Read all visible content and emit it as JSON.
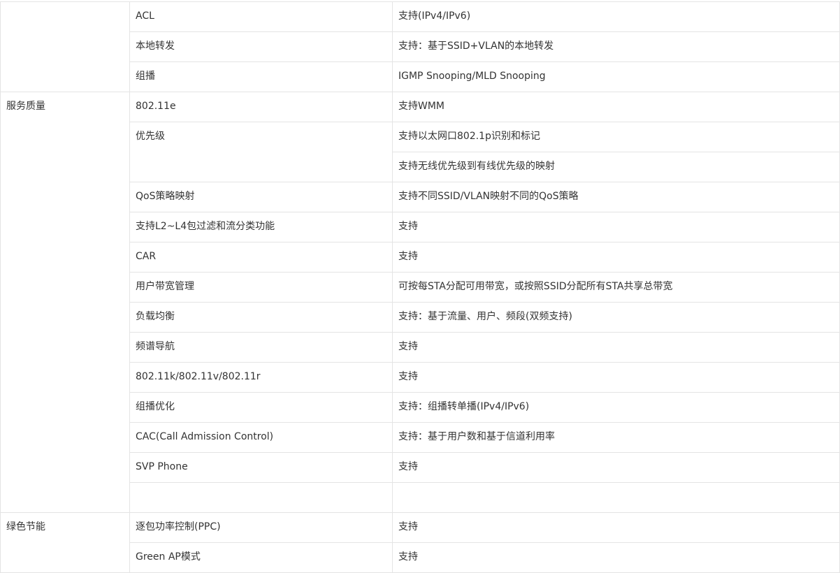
{
  "table": {
    "top_rows": [
      {
        "feature": "ACL",
        "value": "支持(IPv4/IPv6)"
      },
      {
        "feature": "本地转发",
        "value": "支持：基于SSID+VLAN的本地转发"
      },
      {
        "feature": "组播",
        "value": "IGMP Snooping/MLD Snooping"
      }
    ],
    "qos": {
      "category": "服务质量",
      "r802_11e": {
        "feature": "802.11e",
        "value": "支持WMM"
      },
      "priority": {
        "feature": "优先级",
        "value_1": "支持以太网口802.1p识别和标记",
        "value_2": "支持无线优先级到有线优先级的映射"
      },
      "rows": [
        {
          "feature": "QoS策略映射",
          "value": "支持不同SSID/VLAN映射不同的QoS策略"
        },
        {
          "feature": "支持L2~L4包过滤和流分类功能",
          "value": "支持"
        },
        {
          "feature": "CAR",
          "value": "支持"
        },
        {
          "feature": "用户带宽管理",
          "value": "可按每STA分配可用带宽，或按照SSID分配所有STA共享总带宽"
        },
        {
          "feature": "负载均衡",
          "value": "支持：基于流量、用户、频段(双频支持)"
        },
        {
          "feature": "频谱导航",
          "value": "支持"
        },
        {
          "feature": "802.11k/802.11v/802.11r",
          "value": "支持"
        },
        {
          "feature": "组播优化",
          "value": "支持：组播转单播(IPv4/IPv6)"
        },
        {
          "feature": "CAC(Call Admission Control)",
          "value": "支持：基于用户数和基于信道利用率"
        },
        {
          "feature": "SVP Phone",
          "value": "支持"
        }
      ]
    },
    "green": {
      "category": "绿色节能",
      "rows": [
        {
          "feature": "逐包功率控制(PPC)",
          "value": "支持"
        },
        {
          "feature": "Green AP模式",
          "value": "支持"
        }
      ]
    }
  }
}
